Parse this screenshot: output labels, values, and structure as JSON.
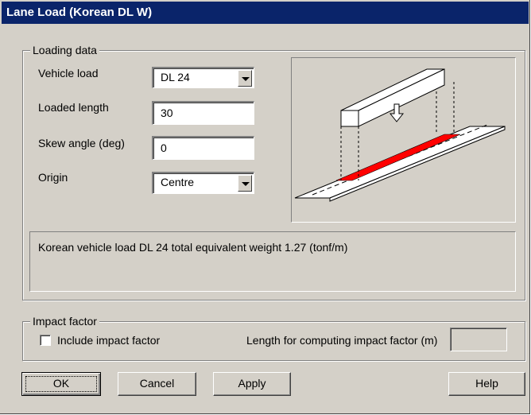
{
  "window": {
    "title": "Lane Load (Korean DL W)"
  },
  "loading_data": {
    "legend": "Loading data",
    "vehicle_load": {
      "label": "Vehicle load",
      "value": "DL 24"
    },
    "loaded_length": {
      "label": "Loaded length",
      "value": "30"
    },
    "skew_angle": {
      "label": "Skew angle (deg)",
      "value": "0"
    },
    "origin": {
      "label": "Origin",
      "value": "Centre"
    },
    "info_text": "Korean vehicle load DL 24 total equivalent weight 1.27 (tonf/m)",
    "diagram": {
      "load_color": "#ff0000"
    }
  },
  "impact_factor": {
    "legend": "Impact factor",
    "include_label": "Include impact factor",
    "include_checked": false,
    "length_label": "Length for computing impact factor (m)",
    "length_value": ""
  },
  "buttons": {
    "ok": "OK",
    "cancel": "Cancel",
    "apply": "Apply",
    "help": "Help"
  },
  "colors": {
    "titlebar": "#0a246a",
    "dialog": "#d4d0c8"
  }
}
